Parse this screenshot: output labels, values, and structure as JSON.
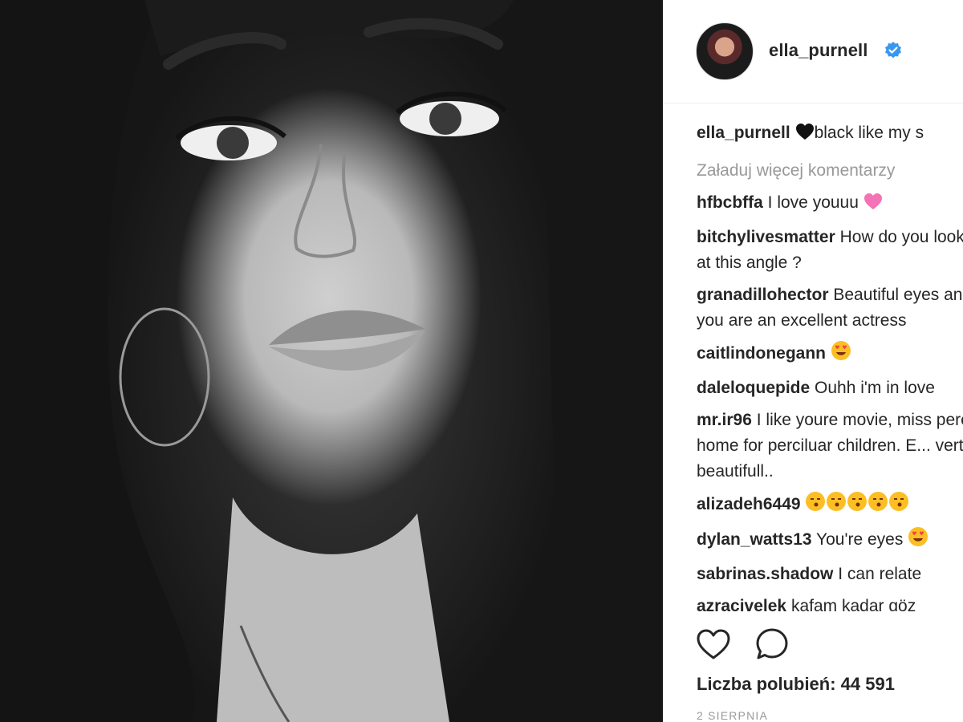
{
  "post": {
    "owner": "ella_purnell",
    "caption_text": "black like my s",
    "load_more": "Załaduj więcej komentarzy",
    "likes_text": "Liczba polubień: 44 591",
    "date": "2 SIERPNIA"
  },
  "comments": [
    {
      "user": "hfbcbffa",
      "text": "I love youuu",
      "emoji": "pink-heart"
    },
    {
      "user": "bitchylivesmatter",
      "text": "How do you look so good at this angle ?"
    },
    {
      "user": "granadillohector",
      "text": "Beautiful eyes and lips, you are an excellent actress"
    },
    {
      "user": "caitlindonegann",
      "text": "",
      "emoji": "heart-eyes"
    },
    {
      "user": "daleloquepide",
      "text": "Ouhh i'm in love"
    },
    {
      "user": "mr.ir96",
      "text": "I like youre movie, miss peregrine's home for perciluar children. E... vert beautifull.."
    },
    {
      "user": "alizadeh6449",
      "text": "",
      "emoji": "kiss-faces"
    },
    {
      "user": "dylan_watts13",
      "text": "You're eyes",
      "emoji": "heart-eyes"
    },
    {
      "user": "sabrinas.shadow",
      "text": "I can relate"
    },
    {
      "user": "azracivelek",
      "text": "kafam kadar göz"
    }
  ],
  "icons": {
    "like": "heart-outline-icon",
    "comment": "comment-bubble-icon",
    "verified": "verified-badge-icon"
  },
  "colors": {
    "verified": "#3897f0",
    "muted": "#999999",
    "text": "#262626"
  }
}
